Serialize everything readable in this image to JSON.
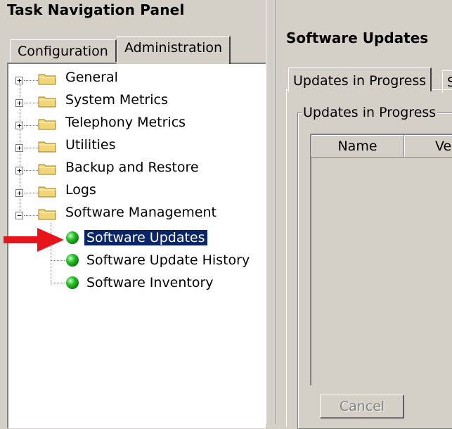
{
  "left_panel": {
    "title": "Task Navigation Panel",
    "tabs": [
      {
        "label": "Configuration"
      },
      {
        "label": "Administration"
      }
    ],
    "tree": [
      {
        "label": "General",
        "type": "folder",
        "expanded": false
      },
      {
        "label": "System Metrics",
        "type": "folder",
        "expanded": false
      },
      {
        "label": "Telephony Metrics",
        "type": "folder",
        "expanded": false
      },
      {
        "label": "Utilities",
        "type": "folder",
        "expanded": false
      },
      {
        "label": "Backup and Restore",
        "type": "folder",
        "expanded": false
      },
      {
        "label": "Logs",
        "type": "folder",
        "expanded": false
      },
      {
        "label": "Software Management",
        "type": "folder",
        "expanded": true
      },
      {
        "label": "Software Updates",
        "type": "leaf",
        "selected": true
      },
      {
        "label": "Software Update History",
        "type": "leaf"
      },
      {
        "label": "Software Inventory",
        "type": "leaf"
      }
    ]
  },
  "right_panel": {
    "title": "Software Updates",
    "tabs": [
      {
        "label": "Updates in Progress"
      },
      {
        "label": "S"
      }
    ],
    "group_label": "Updates in Progress",
    "table_columns": [
      "Name",
      "Ve"
    ],
    "cancel_label": "Cancel"
  },
  "colors": {
    "window_bg": "#d4d0c8",
    "selection_bg": "#0a246a",
    "arrow": "#e8141c",
    "status_ok": "#1faa1f",
    "folder": "#f2d67a"
  },
  "icons": {
    "expand": "plus-box-icon",
    "collapse": "minus-box-icon",
    "folder": "folder-icon",
    "status": "green-ball-icon",
    "pointer": "red-arrow-icon"
  }
}
